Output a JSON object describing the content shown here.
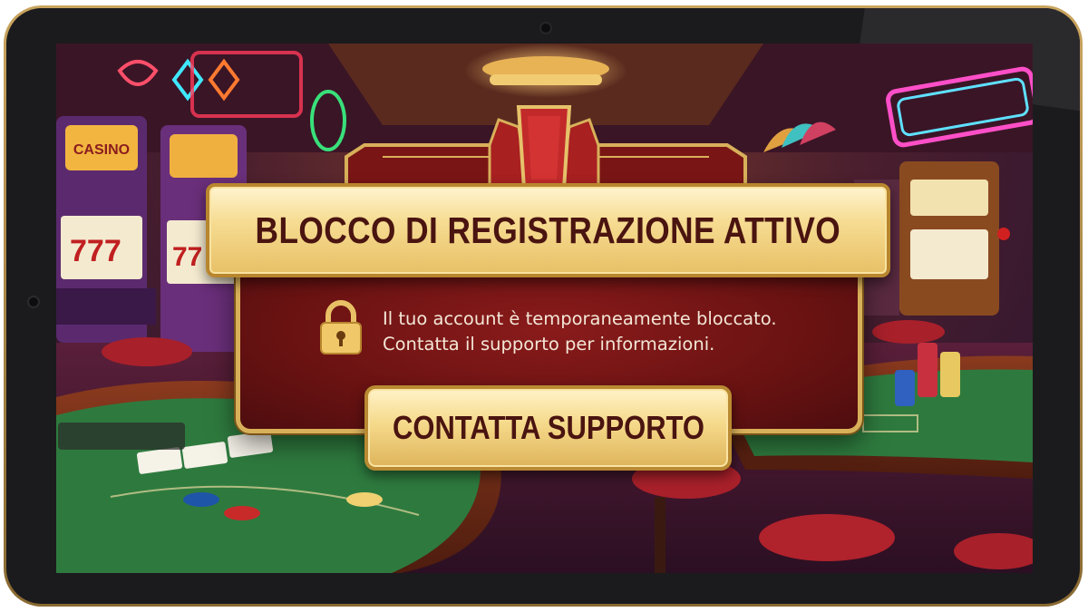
{
  "dialog": {
    "title": "BLOCCO DI REGISTRAZIONE ATTIVO",
    "message_line1": "Il tuo account è temporaneamente bloccato.",
    "message_line2": "Contatta il supporto per informazioni.",
    "button_label": "CONTATTA SUPPORTO",
    "icon": "lock-icon"
  },
  "background": {
    "slot_sign": "CASINO"
  },
  "colors": {
    "gold": "#e8c066",
    "dialog_red": "#6a1212",
    "title_text": "#4a1410",
    "message_text": "#f3e6d6",
    "felt_green": "#2e7a3e"
  }
}
